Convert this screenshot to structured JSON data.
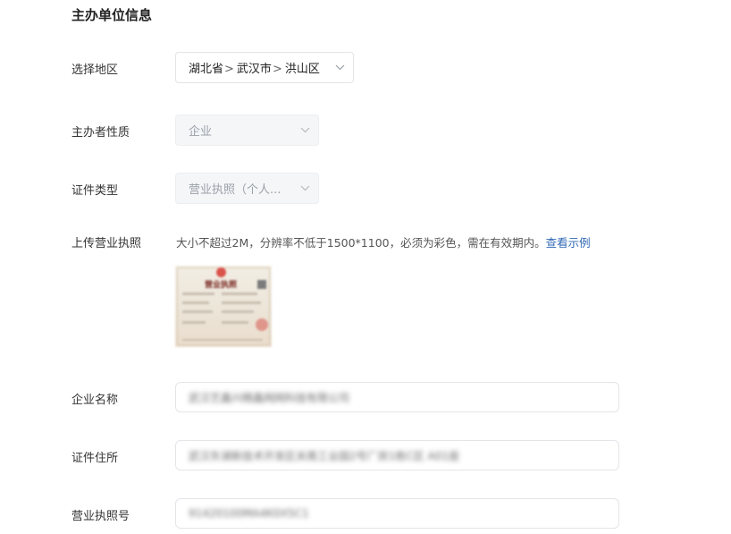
{
  "section": {
    "title": "主办单位信息"
  },
  "fields": {
    "region": {
      "label": "选择地区",
      "province": "湖北省",
      "city": "武汉市",
      "district": "洪山区",
      "separator": ">"
    },
    "organizer_nature": {
      "label": "主办者性质",
      "value": "企业"
    },
    "certificate_type": {
      "label": "证件类型",
      "value": "营业执照（个人..."
    },
    "upload_license": {
      "label": "上传营业执照",
      "hint": "大小不超过2M，分辨率不低于1500*1100，必须为彩色，需在有效期内。",
      "example_link": "查看示例",
      "thumbnail_title": "营业执照"
    },
    "company_name": {
      "label": "企业名称",
      "value": "武汉艺鑫兴精鑫网网科技有限公司"
    },
    "certificate_address": {
      "label": "证件住所",
      "value": "武汉东湖新技术开发区关南工业园2号厂房1栋C区 A01座"
    },
    "license_number": {
      "label": "营业执照号",
      "value": "91420100MA4K0X5C1"
    }
  },
  "icons": {
    "chevron": "chevron-down-icon"
  },
  "colors": {
    "link": "#2f67b5",
    "disabled_bg": "#f5f6f8",
    "border": "#e2e4e8"
  }
}
